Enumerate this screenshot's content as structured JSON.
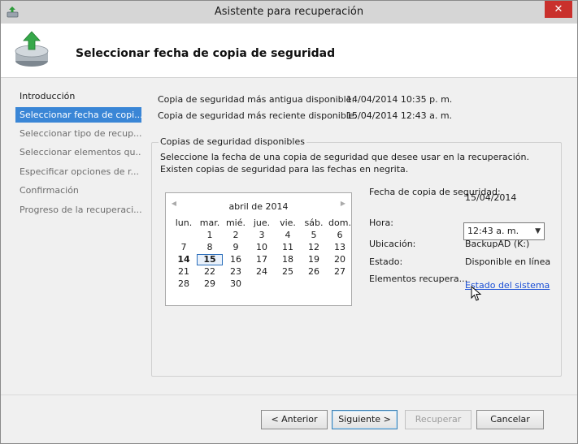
{
  "window": {
    "title": "Asistente para recuperación",
    "close_label": "✕"
  },
  "header": {
    "heading": "Seleccionar fecha de copia de seguridad"
  },
  "sidebar": {
    "items": [
      {
        "label": "Introducción",
        "state": "done"
      },
      {
        "label": "Seleccionar fecha de copi...",
        "state": "active"
      },
      {
        "label": "Seleccionar tipo de recup...",
        "state": "pending"
      },
      {
        "label": "Seleccionar elementos qu...",
        "state": "pending"
      },
      {
        "label": "Especificar opciones de r...",
        "state": "pending"
      },
      {
        "label": "Confirmación",
        "state": "pending"
      },
      {
        "label": "Progreso de la recuperaci...",
        "state": "pending"
      }
    ]
  },
  "info": {
    "oldest_label": "Copia de seguridad más antigua disponible:",
    "oldest_value": "14/04/2014 10:35 p. m.",
    "newest_label": "Copia de seguridad más reciente disponible:",
    "newest_value": "15/04/2014 12:43 a. m."
  },
  "group": {
    "legend": "Copias de seguridad disponibles",
    "description": "Seleccione la fecha de una copia de seguridad que desee usar en la recuperación. Existen copias de seguridad para las fechas en negrita."
  },
  "calendar": {
    "month_title": "abril de 2014",
    "prev_icon": "◀",
    "next_icon": "▶",
    "weekdays": [
      "lun.",
      "mar.",
      "mié.",
      "jue.",
      "vie.",
      "sáb.",
      "dom."
    ],
    "weeks": [
      [
        "",
        "1",
        "2",
        "3",
        "4",
        "5",
        "6"
      ],
      [
        "7",
        "8",
        "9",
        "10",
        "11",
        "12",
        "13"
      ],
      [
        "14",
        "15",
        "16",
        "17",
        "18",
        "19",
        "20"
      ],
      [
        "21",
        "22",
        "23",
        "24",
        "25",
        "26",
        "27"
      ],
      [
        "28",
        "29",
        "30",
        "",
        "",
        "",
        ""
      ]
    ],
    "bold_days": [
      "14",
      "15"
    ],
    "selected_day": "15"
  },
  "details": {
    "date_label": "Fecha de copia de seguridad:",
    "date_value": "15/04/2014",
    "time_label": "Hora:",
    "time_value": "12:43 a. m.",
    "location_label": "Ubicación:",
    "location_value": "BackupAD (K:)",
    "status_label": "Estado:",
    "status_value": "Disponible en línea",
    "items_label": "Elementos recupera...",
    "items_link": "Estado del sistema"
  },
  "footer": {
    "back": "< Anterior",
    "next": "Siguiente >",
    "recover": "Recuperar",
    "cancel": "Cancelar"
  },
  "colors": {
    "accent": "#3a86d6",
    "close": "#c9302c",
    "link": "#1a4fd6"
  }
}
